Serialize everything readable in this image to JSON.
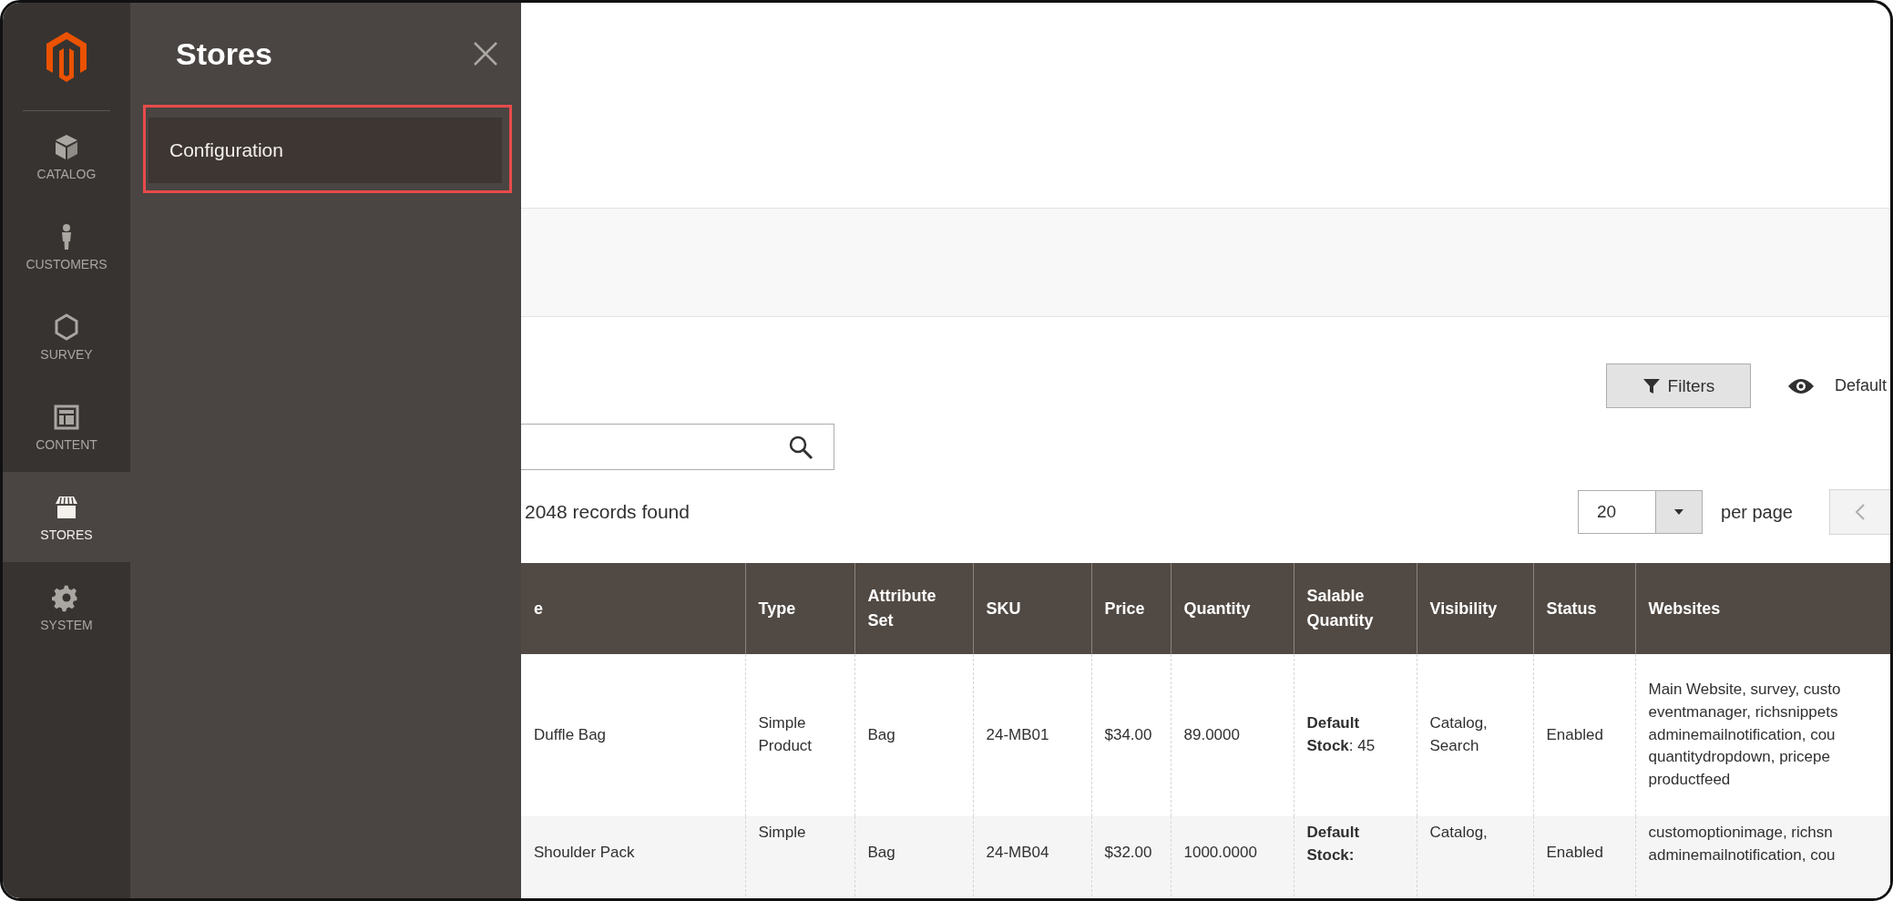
{
  "nav": {
    "items": [
      {
        "label": "CATALOG",
        "kind": "box",
        "selected": false
      },
      {
        "label": "CUSTOMERS",
        "kind": "person",
        "selected": false
      },
      {
        "label": "SURVEY",
        "kind": "hexagon",
        "selected": false
      },
      {
        "label": "CONTENT",
        "kind": "layout",
        "selected": false
      },
      {
        "label": "STORES",
        "kind": "store",
        "selected": true
      },
      {
        "label": "SYSTEM",
        "kind": "gear",
        "selected": false
      }
    ]
  },
  "flyout": {
    "title": "Stores",
    "items": [
      {
        "label": "Configuration",
        "highlighted": true
      }
    ]
  },
  "toolbar": {
    "filters_button": "Filters",
    "view_label": "Default",
    "records": "2048 records found",
    "per_page": {
      "value": "20",
      "label": "per page"
    }
  },
  "table": {
    "columns": [
      "e",
      "Type",
      "Attribute Set",
      "SKU",
      "Price",
      "Quantity",
      "Salable Quantity",
      "Visibility",
      "Status",
      "Websites"
    ],
    "rows": [
      {
        "cells": [
          "Duffle Bag",
          "Simple Product",
          "Bag",
          "24-MB01",
          "$34.00",
          "89.0000",
          "**Default Stock**: 45",
          "Catalog, Search",
          "Enabled"
        ],
        "websites": [
          "Main Website, survey, custo",
          "eventmanager, richsnippets",
          "adminemailnotification, cou",
          "quantitydropdown, pricepe",
          "productfeed"
        ]
      },
      {
        "cells": [
          "Shoulder Pack",
          "Simple",
          "Bag",
          "24-MB04",
          "$32.00",
          "1000.0000",
          "**Default Stock:**",
          "Catalog,",
          "Enabled"
        ],
        "websites": [
          "customoptionimage, richsn",
          "adminemailnotification, cou"
        ]
      }
    ]
  }
}
